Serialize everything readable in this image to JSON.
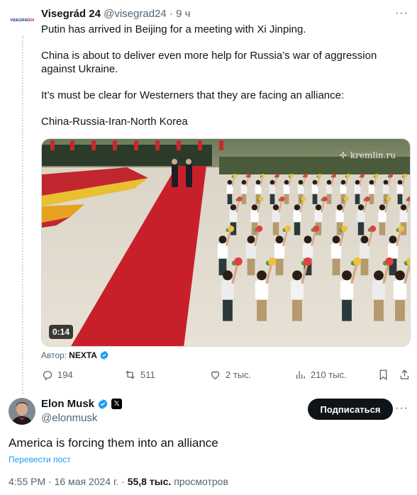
{
  "quoted": {
    "avatar_text_a": "VISEGRÁD",
    "avatar_text_b": "24",
    "name": "Visegrád 24",
    "handle": "@visegrad24",
    "dot": "·",
    "time": "9 ч",
    "paragraphs": [
      "Putin has arrived in Beijing for a meeting with Xi Jinping.",
      "China is about to deliver even more help for Russia’s war of aggression against Ukraine.",
      "It’s must be clear for Westerners that they are facing an alliance:",
      "China-Russia-Iran-North Korea"
    ],
    "media": {
      "duration": "0:14",
      "watermark": "kremlin.ru"
    },
    "author_label": "Автор:",
    "author_source": "NEXTA",
    "stats": {
      "replies": "194",
      "reposts": "511",
      "likes": "2 тыс.",
      "views": "210 тыс."
    }
  },
  "main": {
    "name": "Elon Musk",
    "handle": "@elonmusk",
    "follow_label": "Подписаться",
    "text": "America is forcing them into an alliance",
    "translate_label": "Перевести пост",
    "timestamp": "4:55 PM · 16 мая 2024 г. ·",
    "views_count": "55,8 тыс.",
    "views_label": "просмотров"
  },
  "colors": {
    "accent": "#1d9bf0",
    "text": "#0f1419",
    "secondary": "#536471",
    "verified": "#1d9bf0"
  }
}
